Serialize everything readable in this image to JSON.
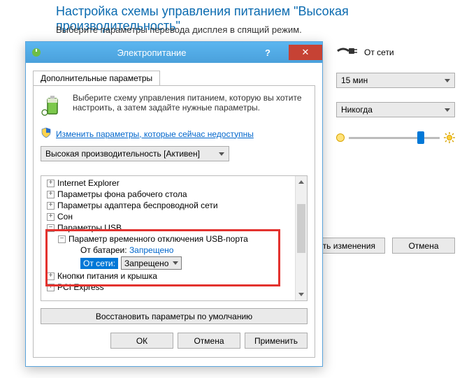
{
  "page": {
    "title": "Настройка схемы управления питанием \"Высокая производительность\"",
    "subtitle": "Выберите параметры перевода дисплея в спящий режим.",
    "ot_seti_label": "От сети",
    "combo_time": "15 мин",
    "combo_never": "Никогда",
    "save_changes": "ранить изменения",
    "cancel": "Отмена"
  },
  "dialog": {
    "title": "Электропитание",
    "help": "?",
    "close": "✕",
    "tab": "Дополнительные параметры",
    "intro": "Выберите схему управления питанием, которую вы хотите настроить, а затем задайте нужные параметры.",
    "change_link": "Изменить параметры, которые сейчас недоступны",
    "scheme_combo": "Высокая производительность [Активен]",
    "restore": "Восстановить параметры по умолчанию",
    "ok": "ОК",
    "cancel": "Отмена",
    "apply": "Применить"
  },
  "tree": {
    "n0": "Internet Explorer",
    "n1": "Параметры фона рабочего стола",
    "n2": "Параметры адаптера беспроводной сети",
    "n3": "Сон",
    "n4": "Параметры USB",
    "n4a": "Параметр временного отключения USB-порта",
    "n4a_bat_label": "От батареи:",
    "n4a_bat_val": "Запрещено",
    "n4a_net_label": "От сети:",
    "n4a_net_val": "Запрещено",
    "n5": "Кнопки питания и крышка",
    "n6": "PCI Express"
  }
}
